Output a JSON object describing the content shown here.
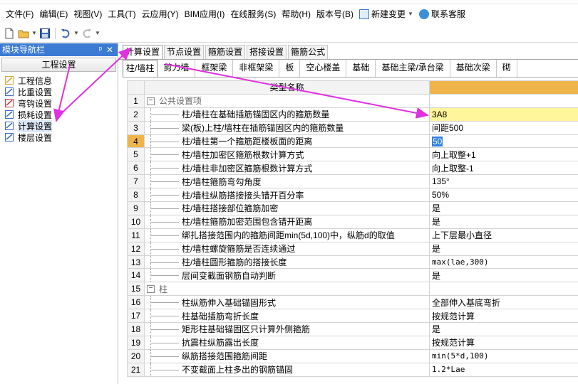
{
  "menus": [
    "文件(F)",
    "编辑(E)",
    "视图(V)",
    "工具(T)",
    "云应用(Y)",
    "BIM应用(I)",
    "在线服务(S)",
    "帮助(H)",
    "版本号(B)"
  ],
  "menu_new_change": "新建变更",
  "menu_support": "联系客服",
  "nav": {
    "title": "模块导航栏",
    "pin": "ᵖ",
    "close": "✕",
    "group": "工程设置",
    "items": [
      {
        "label": "工程信息",
        "icon": "project-info-icon",
        "color": "#d9a43a"
      },
      {
        "label": "比重设置",
        "icon": "weight-settings-icon",
        "color": "#3a6cc7"
      },
      {
        "label": "弯钩设置",
        "icon": "hook-settings-icon",
        "color": "#c23a3a"
      },
      {
        "label": "损耗设置",
        "icon": "loss-settings-icon",
        "color": "#3a6cc7"
      },
      {
        "label": "计算设置",
        "icon": "calc-settings-icon",
        "color": "#3a6cc7"
      },
      {
        "label": "楼层设置",
        "icon": "floor-settings-icon",
        "color": "#3a6cc7"
      }
    ]
  },
  "tabs1": [
    "计算设置",
    "节点设置",
    "箍筋设置",
    "搭接设置",
    "箍筋公式"
  ],
  "tabs2": [
    "柱/墙柱",
    "剪力墙",
    "框架梁",
    "非框架梁",
    "板",
    "空心楼盖",
    "基础",
    "基础主梁/承台梁",
    "基础次梁",
    "砌"
  ],
  "grid": {
    "header_name": "类型名称",
    "header_value": "",
    "rows": [
      {
        "no": "1",
        "name": "公共设置项",
        "value": "",
        "group": true
      },
      {
        "no": "2",
        "name": "柱/墙柱在基础插筋锚固区内的箍筋数量",
        "value": "3A8"
      },
      {
        "no": "3",
        "name": "梁(板)上柱/墙柱在插筋锚固区内的箍筋数量",
        "value": "间距500"
      },
      {
        "no": "4",
        "name": "柱/墙柱第一个箍筋距楼板面的距离",
        "value": "50"
      },
      {
        "no": "5",
        "name": "柱/墙柱加密区箍筋根数计算方式",
        "value": "向上取整+1"
      },
      {
        "no": "6",
        "name": "柱/墙柱非加密区箍筋根数计算方式",
        "value": "向上取整-1"
      },
      {
        "no": "7",
        "name": "柱/墙柱箍筋弯勾角度",
        "value": "135°"
      },
      {
        "no": "8",
        "name": "柱/墙柱纵筋搭接接头错开百分率",
        "value": "50%"
      },
      {
        "no": "9",
        "name": "柱/墙柱搭接部位箍筋加密",
        "value": "是"
      },
      {
        "no": "10",
        "name": "柱/墙柱箍筋加密范围包含错开距离",
        "value": "是"
      },
      {
        "no": "11",
        "name": "绑扎搭接范围内的箍筋间距min(5d,100)中，纵筋d的取值",
        "value": "上下层最小直径"
      },
      {
        "no": "12",
        "name": "柱/墙柱螺旋箍筋是否连续通过",
        "value": "是"
      },
      {
        "no": "13",
        "name": "柱/墙柱圆形箍筋的搭接长度",
        "value": "max(lae,300)"
      },
      {
        "no": "14",
        "name": "层间变截面钢筋自动判断",
        "value": "是"
      },
      {
        "no": "15",
        "name": "柱",
        "value": "",
        "group": true
      },
      {
        "no": "16",
        "name": "柱纵筋伸入基础锚固形式",
        "value": "全部伸入基底弯折"
      },
      {
        "no": "17",
        "name": "柱基础插筋弯折长度",
        "value": "按规范计算"
      },
      {
        "no": "18",
        "name": "矩形柱基础锚固区只计算外侧箍筋",
        "value": "是"
      },
      {
        "no": "19",
        "name": "抗震柱纵筋露出长度",
        "value": "按规范计算"
      },
      {
        "no": "20",
        "name": "纵筋搭接范围箍筋间距",
        "value": "min(5*d,100)"
      },
      {
        "no": "21",
        "name": "不变截面上柱多出的钢筋锚固",
        "value": "1.2*Lae"
      }
    ]
  },
  "colors": {
    "nav_title_bg": "#3c7bd4",
    "header_value_bg": "#f0b54a",
    "highlight_bg": "#fff59a",
    "arrow": "#e030e0"
  }
}
